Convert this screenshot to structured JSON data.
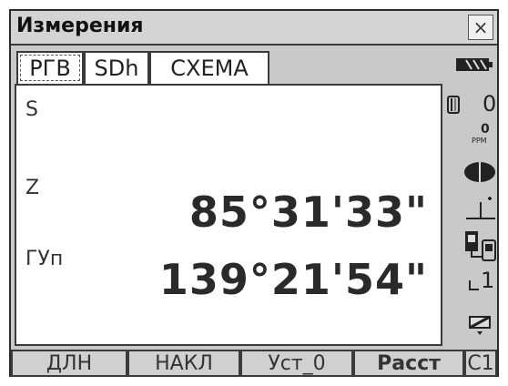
{
  "window": {
    "title": "Измерения",
    "close_label": "×"
  },
  "tabs": [
    {
      "label": "РГВ"
    },
    {
      "label": "SDh"
    },
    {
      "label": "СХЕМА"
    }
  ],
  "measurements": [
    {
      "label": "S",
      "value": ""
    },
    {
      "label": "Z",
      "value": "85°31'33\""
    },
    {
      "label": "ГУп",
      "value": "139°21'54\""
    }
  ],
  "status": {
    "prism_constant": "0",
    "ppm_value": "0",
    "ppm_unit": "PPM",
    "laser_level": "1",
    "icons": [
      "battery-icon",
      "prism-icon",
      "ppm-icon",
      "target-ellipse-icon",
      "tilt-icon",
      "instrument-link-icon",
      "laser-level-icon",
      "compensator-icon"
    ]
  },
  "softkeys": [
    {
      "label": "ДЛН"
    },
    {
      "label": "НАКЛ"
    },
    {
      "label": "Уст_0"
    },
    {
      "label": "Расст"
    },
    {
      "label": "С1"
    }
  ]
}
